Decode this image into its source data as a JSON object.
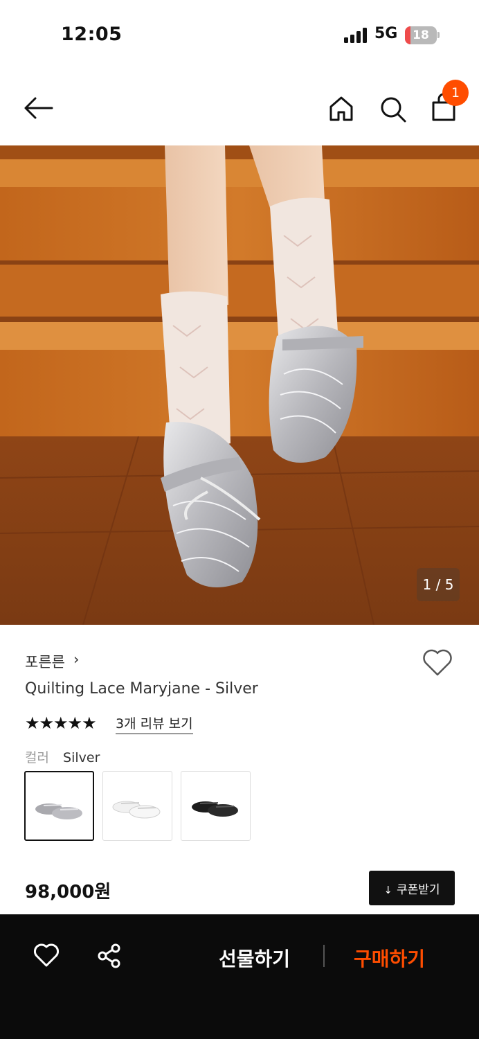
{
  "status": {
    "time": "12:05",
    "network": "5G",
    "battery": "18",
    "battery_fill": 0.18
  },
  "nav": {
    "cart_count": "1",
    "icons": [
      "back-arrow-icon",
      "home-icon",
      "search-icon",
      "shopping-bag-icon"
    ]
  },
  "hero": {
    "counter": "1 / 5"
  },
  "product": {
    "brand": "포른른",
    "brand_chevron": "›",
    "name": "Quilting Lace Maryjane - Silver",
    "stars": "★★★★★",
    "rating": 5,
    "reviews_link": "3개 리뷰 보기",
    "color_label": "컬러",
    "color_value": "Silver",
    "price": "98,000원"
  },
  "coupon": {
    "icon": "↓",
    "label": "쿠폰받기"
  },
  "bottom_bar": {
    "gift_label": "선물하기",
    "buy_label": "구매하기"
  },
  "colors": {
    "accent": "#ff4d00",
    "dark": "#0b0b0b"
  }
}
